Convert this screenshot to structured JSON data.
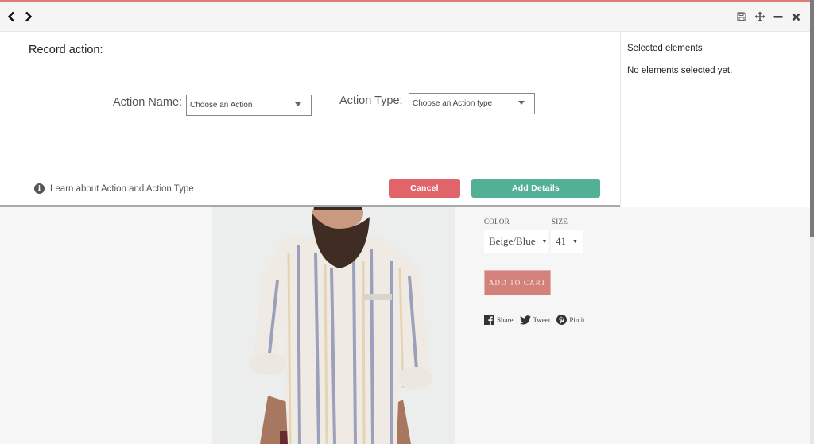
{
  "recorder": {
    "toolbar": {
      "back_icon": "chevron-left-icon",
      "forward_icon": "chevron-right-icon",
      "save_icon": "floppy-disk-icon",
      "move_icon": "move-arrows-icon",
      "minimize_icon": "minus-icon",
      "close_icon": "close-x-icon"
    },
    "title": "Record action:",
    "action_name": {
      "label": "Action Name:",
      "placeholder": "Choose an Action"
    },
    "action_type": {
      "label": "Action Type:",
      "placeholder": "Choose an Action type"
    },
    "learn_link": "Learn about Action and Action Type",
    "cancel_label": "Cancel",
    "add_details_label": "Add Details",
    "sidebar": {
      "title": "Selected elements",
      "empty_message": "No elements selected yet."
    },
    "colors": {
      "accent_top": "#e07a78",
      "cancel": "#e0646a",
      "add_details": "#52b094"
    }
  },
  "store": {
    "color_label": "COLOR",
    "color_value": "Beige/Blue",
    "size_label": "SIZE",
    "size_value": "41",
    "add_to_cart": "ADD TO CART",
    "share": [
      {
        "icon": "facebook-icon",
        "label": "Share"
      },
      {
        "icon": "twitter-icon",
        "label": "Tweet"
      },
      {
        "icon": "pinterest-icon",
        "label": "Pin it"
      }
    ],
    "product_image_alt": "Bearded man wearing striped button-up shirt",
    "colors": {
      "add_to_cart": "#d2827a"
    }
  }
}
